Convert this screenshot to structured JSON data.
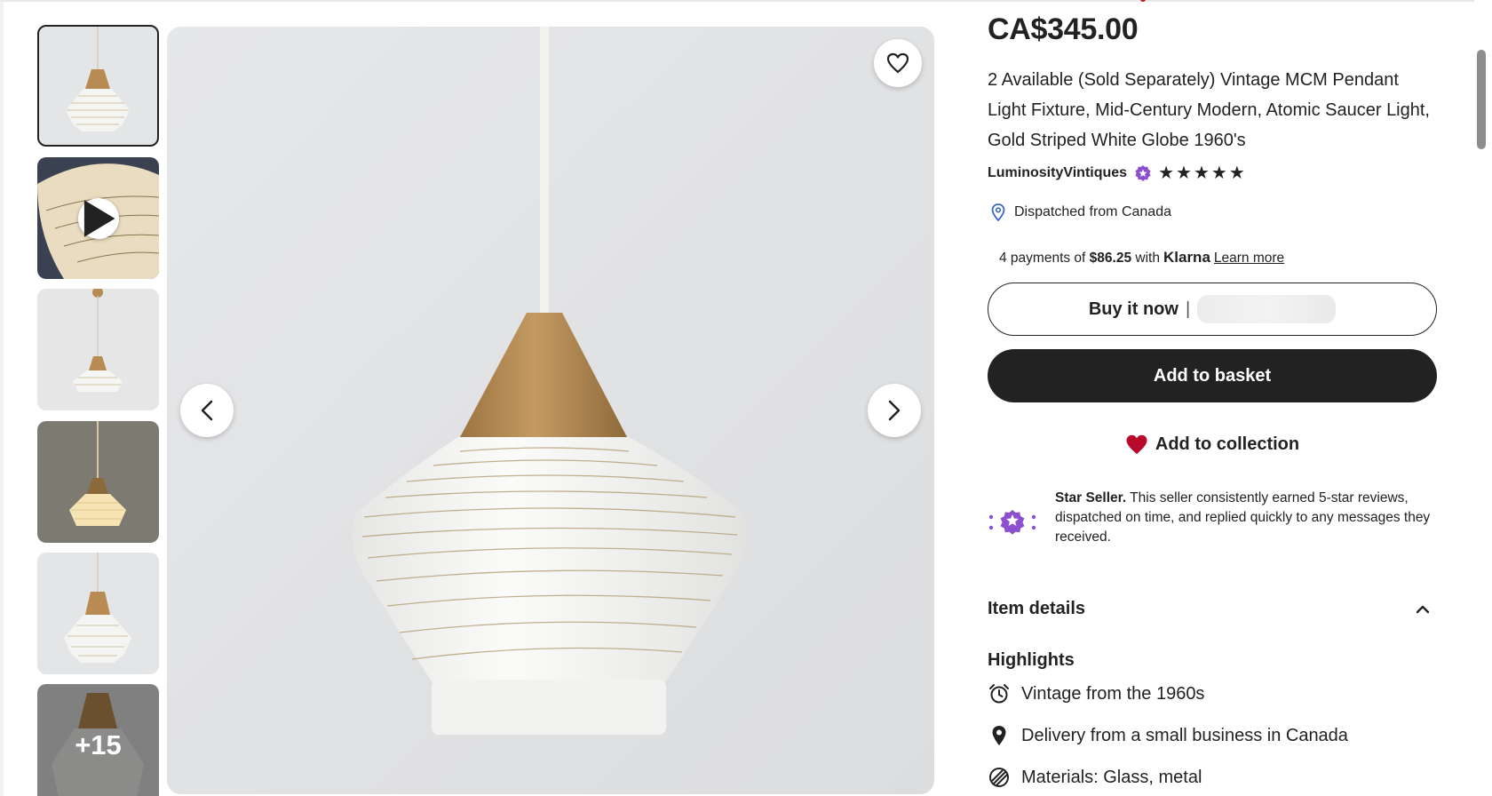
{
  "gallery": {
    "more_count_label": "+15"
  },
  "product": {
    "price": "CA$345.00",
    "title": "2 Available (Sold Separately) Vintage MCM Pendant Light Fixture, Mid-Century Modern, Atomic Saucer Light, Gold Striped White Globe 1960's",
    "shop_name": "LuminosityVintiques",
    "stars": [
      "★",
      "★",
      "★",
      "★",
      "★"
    ],
    "dispatch": "Dispatched from Canada"
  },
  "klarna": {
    "prefix": "4 payments of",
    "amount": "$86.25",
    "with": "with",
    "brand": "Klarna",
    "link": "Learn more"
  },
  "actions": {
    "buy_now": "Buy it now",
    "buy_sep": "|",
    "add_basket": "Add to basket",
    "add_collection": "Add to collection"
  },
  "star_seller": {
    "title": "Star Seller.",
    "text": "This seller consistently earned 5-star reviews, dispatched on time, and replied quickly to any messages they received."
  },
  "details": {
    "heading": "Item details",
    "highlights_heading": "Highlights",
    "highlights": [
      {
        "icon": "alarm-clock-icon",
        "text": "Vintage from the 1960s"
      },
      {
        "icon": "location-pin-icon",
        "text": "Delivery from a small business in Canada"
      },
      {
        "icon": "materials-icon",
        "text": "Materials: Glass, metal"
      }
    ]
  },
  "colors": {
    "accent_dark": "#222222",
    "heart_red": "#b7092b",
    "star_seller_purple": "#8c4fce",
    "pin_blue": "#3b67c8"
  }
}
